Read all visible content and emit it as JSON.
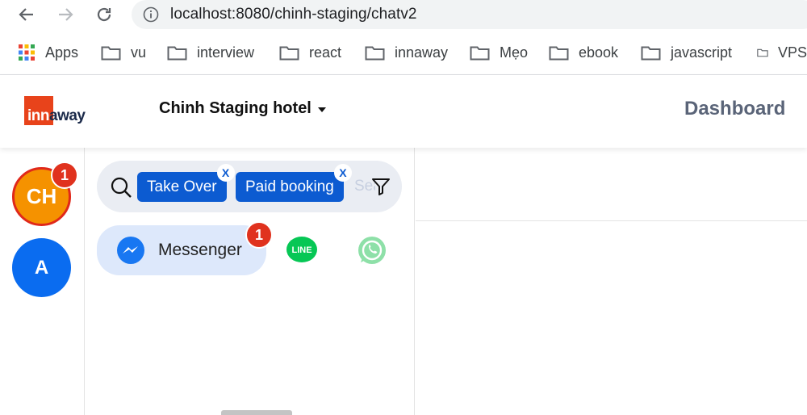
{
  "browser": {
    "url": "localhost:8080/chinh-staging/chatv2",
    "bookmarks": [
      "Apps",
      "vu",
      "interview",
      "react",
      "innaway",
      "Mẹo",
      "ebook",
      "javascript",
      "VPS"
    ]
  },
  "header": {
    "logo": {
      "part1": "inn",
      "part2": "away"
    },
    "hotel_name": "Chinh Staging hotel",
    "dashboard_label": "Dashboard"
  },
  "rail": {
    "avatars": [
      {
        "initials": "CH",
        "badge": "1",
        "color": "#f59200"
      },
      {
        "initials": "A",
        "badge": "",
        "color": "#0a6cf0"
      }
    ]
  },
  "search": {
    "chips": [
      {
        "label": "Take Over",
        "close": "X"
      },
      {
        "label": "Paid booking",
        "close": "X"
      }
    ],
    "placeholder": "Search"
  },
  "channels": {
    "active": {
      "label": "Messenger",
      "badge": "1"
    },
    "line_label": "LINE",
    "others": [
      "line-icon",
      "whatsapp-icon"
    ]
  },
  "colors": {
    "accent": "#0c5bd1",
    "badge": "#e0321e",
    "brand": "#e8431b"
  }
}
